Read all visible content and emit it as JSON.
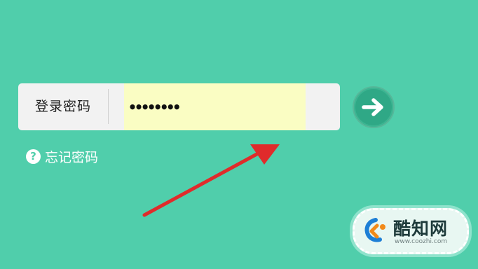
{
  "login": {
    "label": "登录密码",
    "password_value": "••••••••",
    "submit_icon": "arrow-right-icon"
  },
  "forgot": {
    "icon": "help-icon",
    "icon_glyph": "?",
    "label": "忘记密码"
  },
  "watermark": {
    "name": "酷知网",
    "url": "www.coozhi.com"
  },
  "colors": {
    "background": "#50ceab",
    "input_highlight": "#fafdc3",
    "button": "#2fa886",
    "arrow": "#e02b2b"
  }
}
